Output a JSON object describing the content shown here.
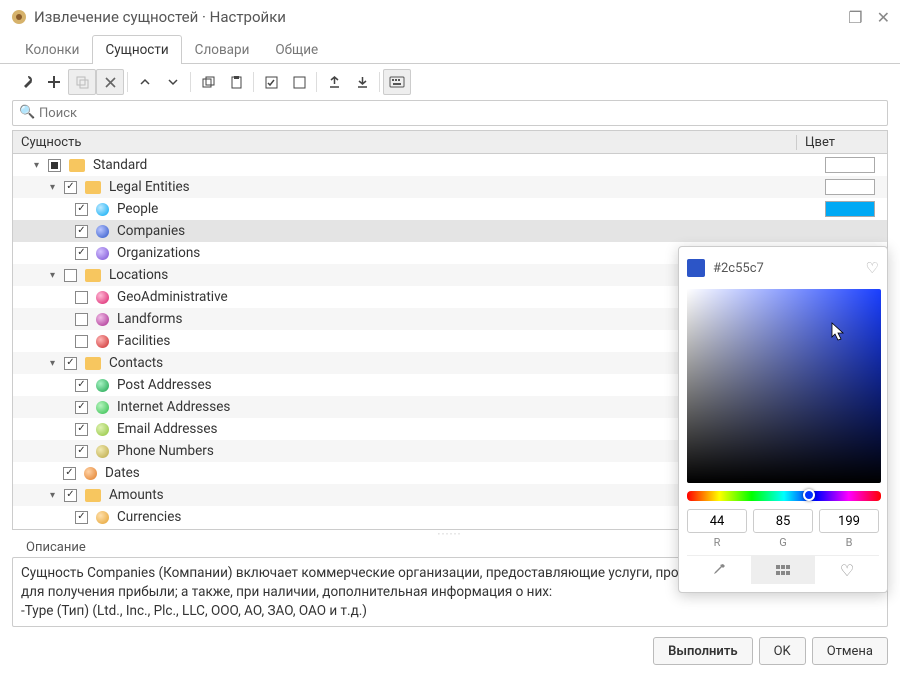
{
  "window": {
    "title": "Извлечение сущностей · Настройки"
  },
  "tabs": [
    "Колонки",
    "Сущности",
    "Словари",
    "Общие"
  ],
  "active_tab": 1,
  "search": {
    "placeholder": "Поиск"
  },
  "table": {
    "head_entity": "Сущность",
    "head_color": "Цвет"
  },
  "tree": {
    "root": {
      "label": "Standard",
      "state": "mixed",
      "swatch": "#ffffff"
    },
    "legal": {
      "label": "Legal Entities",
      "state": "checked",
      "swatch": "#ffffff"
    },
    "people": {
      "label": "People",
      "color": "#00a9f4",
      "swatch": "#00a9f4"
    },
    "companies": {
      "label": "Companies",
      "color": "#2c55c7"
    },
    "organizations": {
      "label": "Organizations",
      "color": "#7a4fd4"
    },
    "locations": {
      "label": "Locations",
      "state": "unchecked"
    },
    "geoadmin": {
      "label": "GeoAdministrative",
      "color": "#d91e6a"
    },
    "landforms": {
      "label": "Landforms",
      "color": "#a82b8e"
    },
    "facilities": {
      "label": "Facilities",
      "color": "#c92a2a"
    },
    "contacts": {
      "label": "Contacts",
      "state": "checked"
    },
    "post": {
      "label": "Post Addresses",
      "color": "#19a24b"
    },
    "internet": {
      "label": "Internet Addresses",
      "color": "#2fbc4a"
    },
    "email": {
      "label": "Email Addresses",
      "color": "#8fc43b"
    },
    "phone": {
      "label": "Phone Numbers",
      "color": "#b9a642"
    },
    "dates": {
      "label": "Dates",
      "color": "#e07b26"
    },
    "amounts": {
      "label": "Amounts",
      "state": "checked"
    },
    "currencies": {
      "label": "Currencies",
      "color": "#e4a12f"
    }
  },
  "description": {
    "label": "Описание",
    "body": "Сущность Companies (Компании) включает коммерческие организации, предоставляющие услуги, продукты или реализующие идеи для получения прибыли; а также, при наличии, дополнительная информация о них:\n-Type (Тип) (Ltd., Inc., Plc., LLC, ООО, АО, ЗАО, ОАО и т.д.)"
  },
  "buttons": {
    "run": "Выполнить",
    "ok": "OK",
    "cancel": "Отмена"
  },
  "picker": {
    "hex": "#2c55c7",
    "r": "44",
    "g": "85",
    "b": "199",
    "labelR": "R",
    "labelG": "G",
    "labelB": "B",
    "swatch": "#2c55c7",
    "hue_pos": "63%",
    "sv_x": "78%",
    "sv_y": "22%"
  }
}
